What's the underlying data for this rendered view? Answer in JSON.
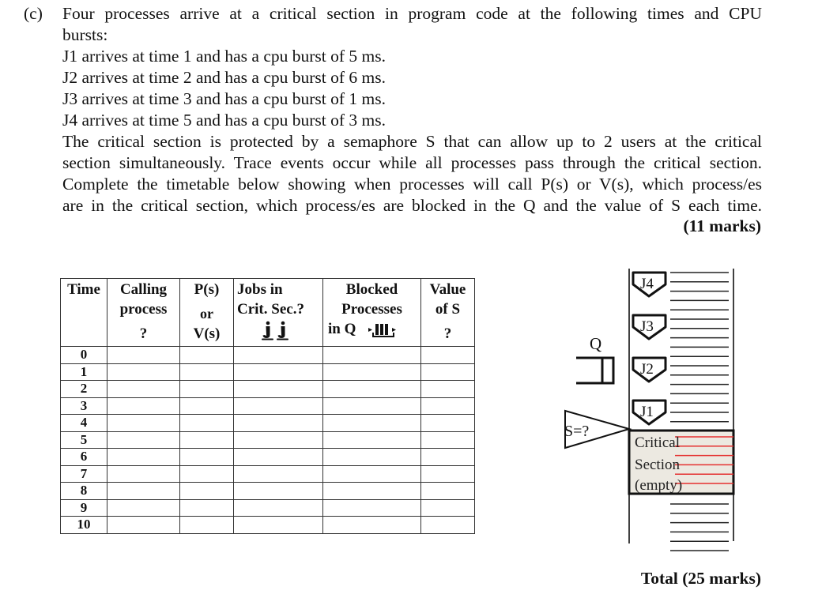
{
  "question": {
    "label": "(c)",
    "lines": [
      "Four processes arrive at a critical section in program code at the following times and CPU",
      "bursts:",
      "J1 arrives at time 1 and has a cpu burst of 5 ms.",
      "J2 arrives at time 2 and has a cpu burst of 6 ms.",
      "J3 arrives at time 3 and has a cpu burst of 1 ms.",
      "J4 arrives at time 5 and has a cpu burst of 3 ms.",
      "The critical section is protected by a semaphore S that can allow up to 2 users at the critical",
      "section simultaneously. Trace events occur while all processes pass through the critical section.",
      "Complete the timetable below showing when processes will call P(s) or V(s), which process/es",
      "are in the critical section, which process/es are blocked in the Q and the value of S each time."
    ],
    "marks": "(11 marks)"
  },
  "processes": [
    {
      "id": "J1",
      "arrival": 1,
      "burst_ms": 5
    },
    {
      "id": "J2",
      "arrival": 2,
      "burst_ms": 6
    },
    {
      "id": "J3",
      "arrival": 3,
      "burst_ms": 1
    },
    {
      "id": "J4",
      "arrival": 5,
      "burst_ms": 3
    }
  ],
  "table": {
    "headers": {
      "time": [
        "Time"
      ],
      "calling": [
        "Calling",
        "process",
        "?"
      ],
      "ps": [
        "P(s)",
        "or",
        "V(s)"
      ],
      "jobs": [
        "Jobs in",
        "Crit. Sec.?"
      ],
      "blocked": [
        "Blocked",
        "Processes",
        "in Q"
      ],
      "value": [
        "Value",
        "of S",
        "?"
      ]
    },
    "header_icons": {
      "jobs": "two-people-icon",
      "blocked": "queue-icon"
    },
    "rows": [
      {
        "time": "0",
        "calling": "",
        "ps": "",
        "jobs": "",
        "blocked": "",
        "value": ""
      },
      {
        "time": "1",
        "calling": "",
        "ps": "",
        "jobs": "",
        "blocked": "",
        "value": ""
      },
      {
        "time": "2",
        "calling": "",
        "ps": "",
        "jobs": "",
        "blocked": "",
        "value": ""
      },
      {
        "time": "3",
        "calling": "",
        "ps": "",
        "jobs": "",
        "blocked": "",
        "value": ""
      },
      {
        "time": "4",
        "calling": "",
        "ps": "",
        "jobs": "",
        "blocked": "",
        "value": ""
      },
      {
        "time": "5",
        "calling": "",
        "ps": "",
        "jobs": "",
        "blocked": "",
        "value": ""
      },
      {
        "time": "6",
        "calling": "",
        "ps": "",
        "jobs": "",
        "blocked": "",
        "value": ""
      },
      {
        "time": "7",
        "calling": "",
        "ps": "",
        "jobs": "",
        "blocked": "",
        "value": ""
      },
      {
        "time": "8",
        "calling": "",
        "ps": "",
        "jobs": "",
        "blocked": "",
        "value": ""
      },
      {
        "time": "9",
        "calling": "",
        "ps": "",
        "jobs": "",
        "blocked": "",
        "value": ""
      },
      {
        "time": "10",
        "calling": "",
        "ps": "",
        "jobs": "",
        "blocked": "",
        "value": ""
      }
    ]
  },
  "diagram": {
    "queue_label": "Q",
    "semaphore_label": "S=?",
    "jobs": [
      "J4",
      "J3",
      "J2",
      "J1"
    ],
    "critical_section": [
      "Critical",
      "Section",
      "(empty)"
    ],
    "colors": {
      "critical_fill": "#ece9e1",
      "critical_lines": "#e53030",
      "ink": "#111111"
    }
  },
  "footer": {
    "total": "Total (25 marks)"
  }
}
